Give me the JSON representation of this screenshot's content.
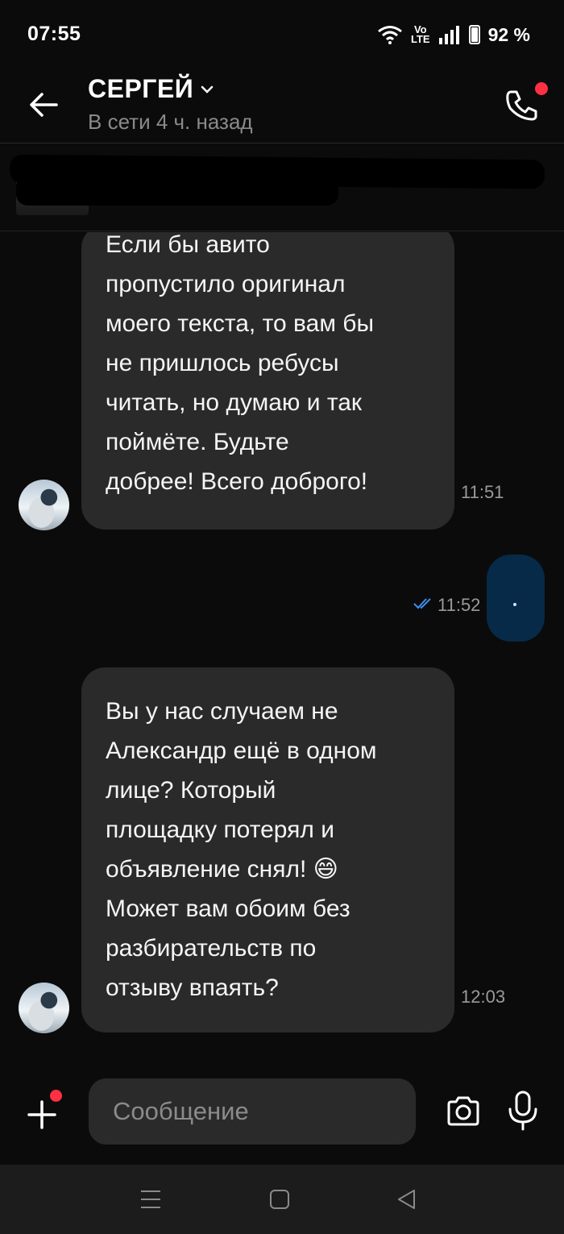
{
  "status": {
    "time": "07:55",
    "battery": "92 %",
    "volte_top": "Vo",
    "volte_bottom": "LTE"
  },
  "header": {
    "name": "СЕРГЕЙ",
    "status": "В сети 4 ч. назад"
  },
  "messages": [
    {
      "dir": "in",
      "lines": [
        "Если бы авито",
        "пропустило оригинал",
        "моего текста, то вам бы",
        "не пришлось ребусы",
        "читать, но думаю и так",
        "поймёте. Будьте",
        "добрее! Всего доброго!"
      ],
      "time": "11:51"
    },
    {
      "dir": "out",
      "text": ".",
      "time": "11:52"
    },
    {
      "dir": "in",
      "lines": [
        "Вы у нас случаем не",
        "Александр ещё в одном",
        "лице? Который",
        "площадку потерял и",
        "объявление снял! 😄",
        "Может вам обоим без",
        "разбирательств по",
        "отзыву впаять?"
      ],
      "time": "12:03"
    }
  ],
  "composer": {
    "placeholder": "Сообщение"
  },
  "colors": {
    "incoming_bubble": "#2a2a2a",
    "outgoing_bubble": "#062a48",
    "accent_dot": "#ff2f44",
    "read_check": "#3d8ef0"
  },
  "icons": [
    "back-arrow-icon",
    "chevron-down-icon",
    "phone-icon",
    "plus-icon",
    "camera-icon",
    "microphone-icon",
    "wifi-icon",
    "signal-icon",
    "battery-icon"
  ]
}
